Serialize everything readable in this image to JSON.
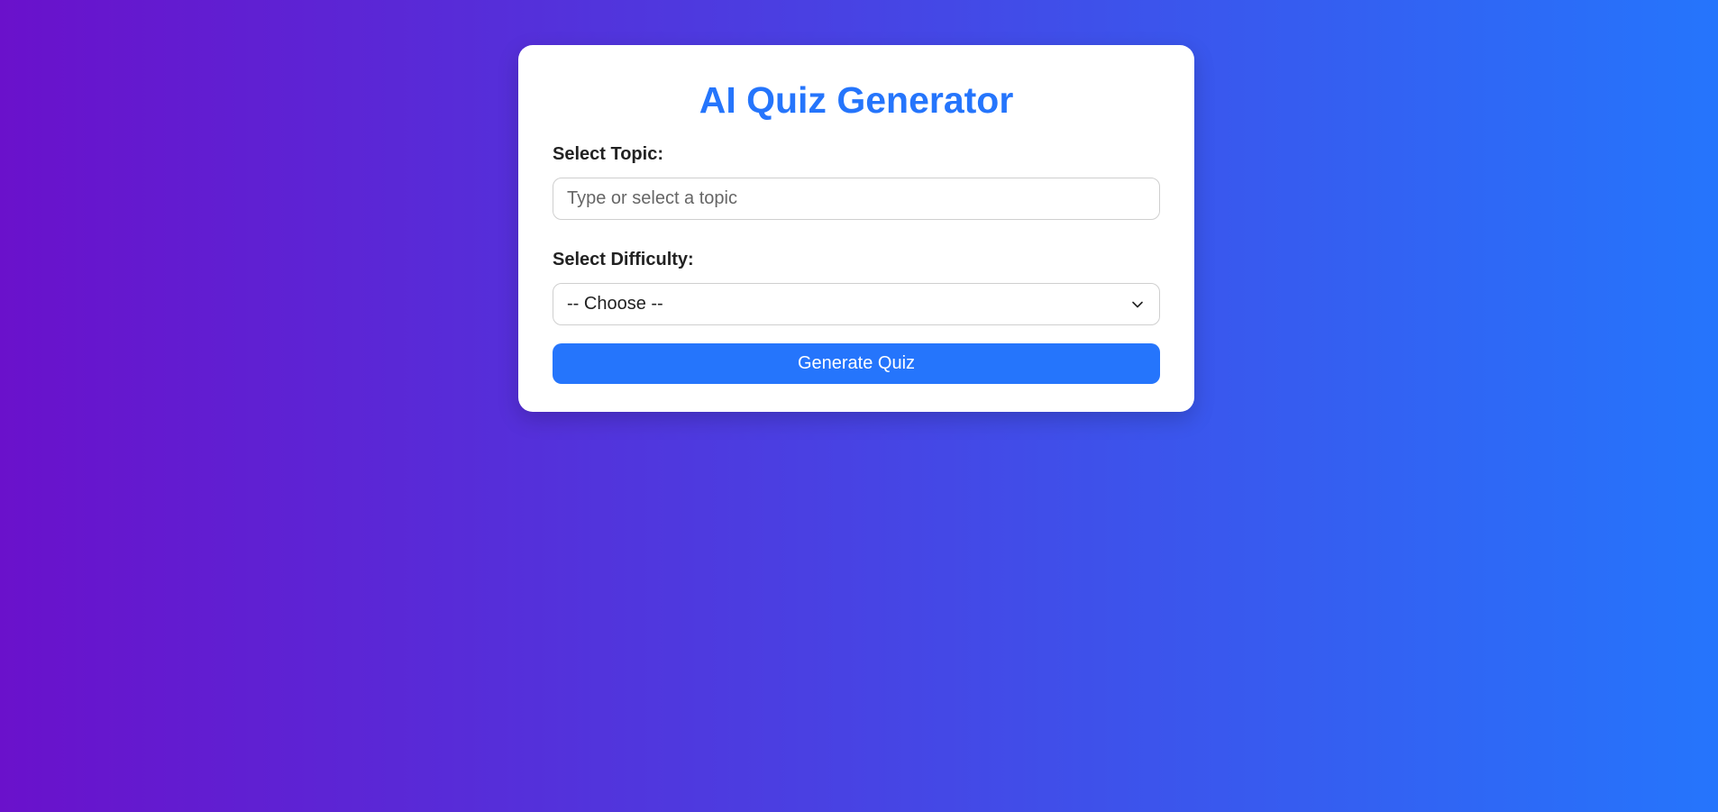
{
  "app": {
    "title": "AI Quiz Generator"
  },
  "form": {
    "topic_label": "Select Topic:",
    "topic_placeholder": "Type or select a topic",
    "topic_value": "",
    "difficulty_label": "Select Difficulty:",
    "difficulty_selected": "-- Choose --",
    "submit_label": "Generate Quiz"
  },
  "icons": {
    "dropdown": "chevron-down-icon"
  },
  "colors": {
    "accent": "#2575fc",
    "gradient_start": "#6a11cb",
    "gradient_end": "#2575fc"
  }
}
